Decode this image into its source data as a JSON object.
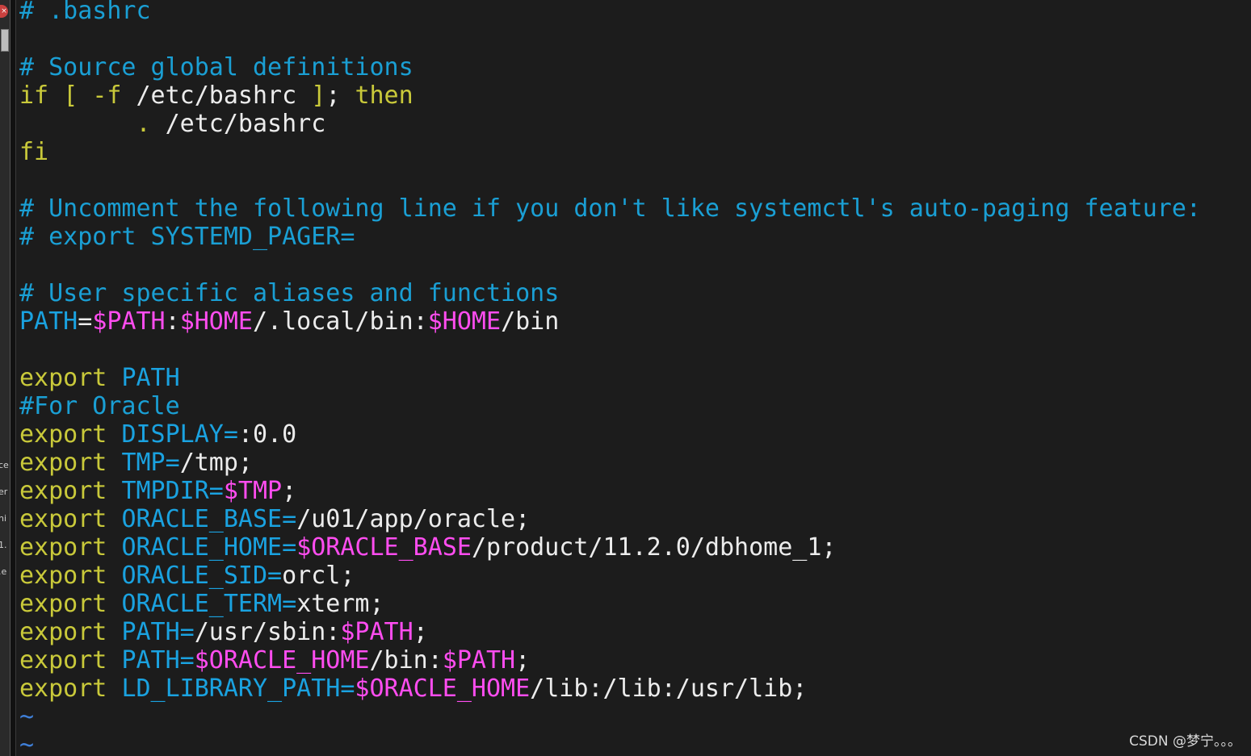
{
  "sidebar_fragments": {
    "close_glyph": "×",
    "items": [
      "ce",
      "er",
      "ni",
      "1.",
      ".e"
    ]
  },
  "file_lines": [
    [
      {
        "t": "# .bashrc",
        "c": "cmt"
      }
    ],
    [],
    [
      {
        "t": "# Source global definitions",
        "c": "cmt"
      }
    ],
    [
      {
        "t": "if",
        "c": "kw"
      },
      {
        "t": " ",
        "c": "txt"
      },
      {
        "t": "[",
        "c": "kw"
      },
      {
        "t": " ",
        "c": "txt"
      },
      {
        "t": "-f",
        "c": "kw"
      },
      {
        "t": " /etc/bashrc ",
        "c": "txt"
      },
      {
        "t": "]",
        "c": "kw"
      },
      {
        "t": "; ",
        "c": "txt"
      },
      {
        "t": "then",
        "c": "kw"
      }
    ],
    [
      {
        "t": "        ",
        "c": "txt"
      },
      {
        "t": ".",
        "c": "kw"
      },
      {
        "t": " /etc/bashrc",
        "c": "txt"
      }
    ],
    [
      {
        "t": "fi",
        "c": "kw"
      }
    ],
    [],
    [
      {
        "t": "# Uncomment the following line if you don't like systemctl's auto-paging feature:",
        "c": "cmt"
      }
    ],
    [
      {
        "t": "# export SYSTEMD_PAGER=",
        "c": "cmt"
      }
    ],
    [],
    [
      {
        "t": "# User specific aliases and functions",
        "c": "cmt"
      }
    ],
    [
      {
        "t": "PATH",
        "c": "id"
      },
      {
        "t": "=",
        "c": "txt"
      },
      {
        "t": "$PATH",
        "c": "var"
      },
      {
        "t": ":",
        "c": "txt"
      },
      {
        "t": "$HOME",
        "c": "var"
      },
      {
        "t": "/.local/bin:",
        "c": "txt"
      },
      {
        "t": "$HOME",
        "c": "var"
      },
      {
        "t": "/bin",
        "c": "txt"
      }
    ],
    [],
    [
      {
        "t": "export",
        "c": "kw"
      },
      {
        "t": " ",
        "c": "txt"
      },
      {
        "t": "PATH",
        "c": "id"
      }
    ],
    [
      {
        "t": "#For Oracle",
        "c": "cmt"
      }
    ],
    [
      {
        "t": "export",
        "c": "kw"
      },
      {
        "t": " ",
        "c": "txt"
      },
      {
        "t": "DISPLAY=",
        "c": "id"
      },
      {
        "t": ":0.0",
        "c": "txt"
      }
    ],
    [
      {
        "t": "export",
        "c": "kw"
      },
      {
        "t": " ",
        "c": "txt"
      },
      {
        "t": "TMP=",
        "c": "id"
      },
      {
        "t": "/tmp;",
        "c": "txt"
      }
    ],
    [
      {
        "t": "export",
        "c": "kw"
      },
      {
        "t": " ",
        "c": "txt"
      },
      {
        "t": "TMPDIR=",
        "c": "id"
      },
      {
        "t": "$TMP",
        "c": "var"
      },
      {
        "t": ";",
        "c": "txt"
      }
    ],
    [
      {
        "t": "export",
        "c": "kw"
      },
      {
        "t": " ",
        "c": "txt"
      },
      {
        "t": "ORACLE_BASE=",
        "c": "id"
      },
      {
        "t": "/u01/app/oracle;",
        "c": "txt"
      }
    ],
    [
      {
        "t": "export",
        "c": "kw"
      },
      {
        "t": " ",
        "c": "txt"
      },
      {
        "t": "ORACLE_HOME=",
        "c": "id"
      },
      {
        "t": "$ORACLE_BASE",
        "c": "var"
      },
      {
        "t": "/product/11.2.0/dbhome_1;",
        "c": "txt"
      }
    ],
    [
      {
        "t": "export",
        "c": "kw"
      },
      {
        "t": " ",
        "c": "txt"
      },
      {
        "t": "ORACLE_SID=",
        "c": "id"
      },
      {
        "t": "orcl;",
        "c": "txt"
      }
    ],
    [
      {
        "t": "export",
        "c": "kw"
      },
      {
        "t": " ",
        "c": "txt"
      },
      {
        "t": "ORACLE_TERM=",
        "c": "id"
      },
      {
        "t": "xterm;",
        "c": "txt"
      }
    ],
    [
      {
        "t": "export",
        "c": "kw"
      },
      {
        "t": " ",
        "c": "txt"
      },
      {
        "t": "PATH=",
        "c": "id"
      },
      {
        "t": "/usr/sbin:",
        "c": "txt"
      },
      {
        "t": "$PATH",
        "c": "var"
      },
      {
        "t": ";",
        "c": "txt"
      }
    ],
    [
      {
        "t": "export",
        "c": "kw"
      },
      {
        "t": " ",
        "c": "txt"
      },
      {
        "t": "PATH=",
        "c": "id"
      },
      {
        "t": "$ORACLE_HOME",
        "c": "var"
      },
      {
        "t": "/bin:",
        "c": "txt"
      },
      {
        "t": "$PATH",
        "c": "var"
      },
      {
        "t": ";",
        "c": "txt"
      }
    ],
    [
      {
        "t": "export",
        "c": "kw"
      },
      {
        "t": " ",
        "c": "txt"
      },
      {
        "t": "LD_LIBRARY_PATH=",
        "c": "id"
      },
      {
        "t": "$ORACLE_HOME",
        "c": "var"
      },
      {
        "t": "/lib:/lib:/usr/lib;",
        "c": "txt"
      }
    ],
    [
      {
        "t": "~",
        "c": "tilde"
      }
    ],
    [
      {
        "t": "~",
        "c": "tilde"
      }
    ]
  ],
  "watermark": "CSDN @梦宁。。。",
  "colors": {
    "background": "#1c1c1c",
    "comment": "#1a9fd4",
    "keyword": "#c9c93a",
    "variable": "#ff4df0",
    "identifier": "#1aa2e0",
    "text": "#ececec",
    "tilde": "#3f7fd8"
  }
}
